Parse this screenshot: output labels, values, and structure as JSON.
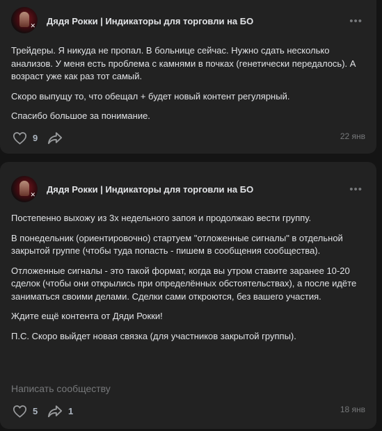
{
  "posts": [
    {
      "author": "Дядя Рокки | Индикаторы для торговли на БО",
      "more": "•••",
      "avatar_mark": "✕",
      "paragraphs": [
        "Трейдеры. Я никуда не пропал. В больнице сейчас. Нужно сдать несколько анализов. У меня есть проблема с камнями в почках (генетически передалось). А возраст уже как раз тот самый.",
        "Скоро выпущу то, что обещал + будет новый контент регулярный.",
        "Спасибо большое за понимание."
      ],
      "likes": "9",
      "date": "22 янв"
    },
    {
      "author": "Дядя Рокки | Индикаторы для торговли на БО",
      "more": "•••",
      "avatar_mark": "✕",
      "paragraphs": [
        "Постепенно выхожу из 3х недельного запоя и продолжаю вести группу.",
        "В понедельник (ориентировочно) стартуем \"отложенные сигналы\" в отдельной закрытой группе (чтобы туда попасть - пишем в сообщения сообщества).",
        "Отложенные сигналы - это такой формат, когда вы утром ставите заранее 10-20 сделок (чтобы они открылись при определённых обстоятельствах), а после идёте заниматься своими делами. Сделки сами откроются, без вашего участия.",
        "Ждите ещё контента от Дяди Рокки!",
        "П.С. Скоро выйдет новая связка (для участников закрытой группы)."
      ],
      "comment_placeholder": "Написать сообществу",
      "likes": "5",
      "shares": "1",
      "date": "18 янв"
    }
  ],
  "colors": {
    "background": "#141414",
    "card": "#222222",
    "text": "#e1e3e6",
    "secondary": "#76787a"
  },
  "icons": [
    "heart-icon",
    "share-icon",
    "more-icon"
  ]
}
